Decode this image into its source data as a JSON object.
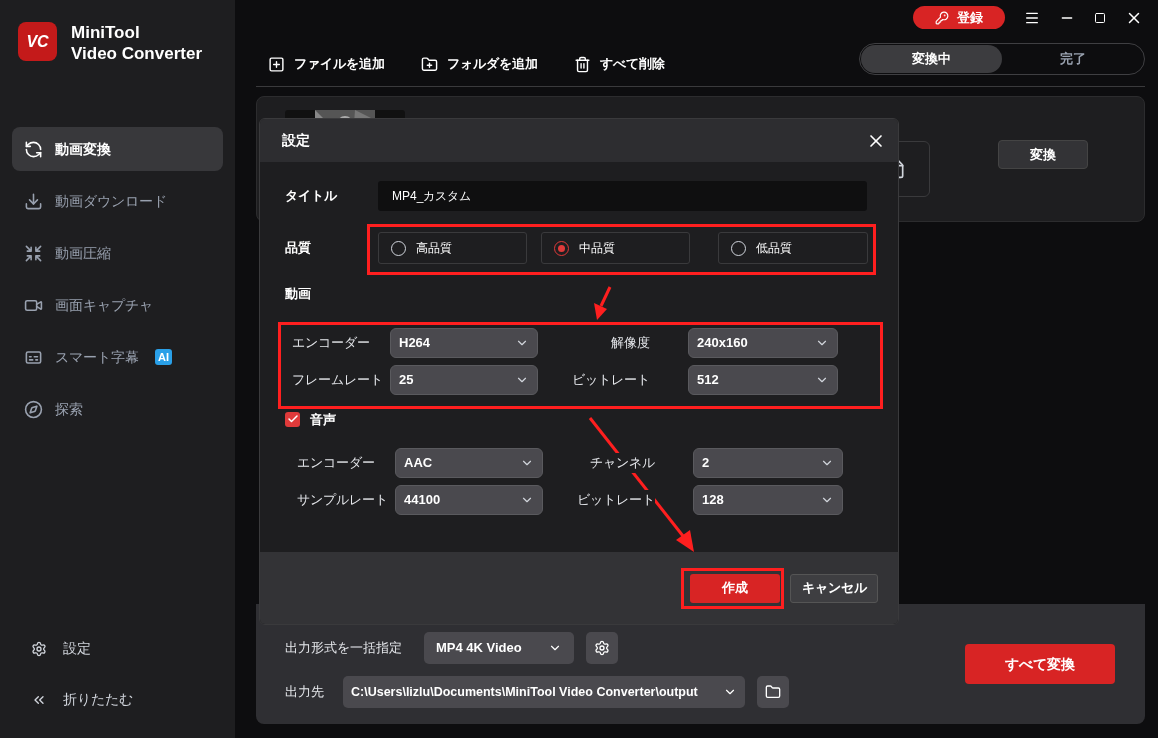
{
  "app": {
    "name_lines": [
      "MiniTool",
      "Video Converter"
    ],
    "logo_text": "VC"
  },
  "sidebar": {
    "items": [
      {
        "label": "動画変換",
        "selected": true,
        "kind": "convert"
      },
      {
        "label": "動画ダウンロード",
        "selected": false,
        "kind": "download"
      },
      {
        "label": "動画圧縮",
        "selected": false,
        "kind": "compress"
      },
      {
        "label": "画面キャプチャ",
        "selected": false,
        "kind": "capture"
      },
      {
        "label": "スマート字幕",
        "selected": false,
        "kind": "subtitle",
        "badge": "AI"
      },
      {
        "label": "探索",
        "selected": false,
        "kind": "explore"
      }
    ],
    "footer": [
      {
        "label": "設定",
        "kind": "settings"
      },
      {
        "label": "折りたたむ",
        "kind": "collapse"
      }
    ]
  },
  "titlebar": {
    "register": "登録"
  },
  "toolbar": [
    {
      "label": "ファイルを追加",
      "kind": "add-file"
    },
    {
      "label": "フォルダを追加",
      "kind": "add-folder"
    },
    {
      "label": "すべて削除",
      "kind": "delete"
    }
  ],
  "tabs": [
    {
      "label": "変換中",
      "selected": true
    },
    {
      "label": "完了",
      "selected": false
    }
  ],
  "file_card": {
    "convert": "変換"
  },
  "dialog": {
    "title": "設定",
    "title_label": "タイトル",
    "title_value": "MP4_カスタム",
    "quality_label": "品質",
    "quality": [
      {
        "label": "高品質",
        "selected": false
      },
      {
        "label": "中品質",
        "selected": true
      },
      {
        "label": "低品質",
        "selected": false
      }
    ],
    "video_label": "動画",
    "video": [
      {
        "label": "エンコーダー",
        "value": "H264"
      },
      {
        "label": "解像度",
        "value": "240x160"
      },
      {
        "label": "フレームレート",
        "value": "25"
      },
      {
        "label": "ビットレート",
        "value": "512"
      }
    ],
    "audio_label": "音声",
    "audio_checked": true,
    "audio": [
      {
        "label": "エンコーダー",
        "value": "AAC"
      },
      {
        "label": "チャンネル",
        "value": "2"
      },
      {
        "label": "サンプルレート",
        "value": "44100"
      },
      {
        "label": "ビットレート",
        "value": "128"
      }
    ],
    "create": "作成",
    "cancel": "キャンセル"
  },
  "bottom": {
    "format_label": "出力形式を一括指定",
    "format_value": "MP4 4K Video",
    "dest_label": "出力先",
    "dest_value": "C:\\Users\\lizlu\\Documents\\MiniTool Video Converter\\output",
    "convert_all": "すべて変換"
  }
}
